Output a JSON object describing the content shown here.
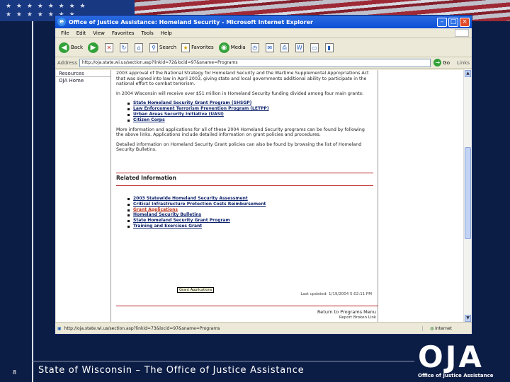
{
  "browser": {
    "title": "Office of Justice Assistance: Homeland Security - Microsoft Internet Explorer",
    "menu": [
      "File",
      "Edit",
      "View",
      "Favorites",
      "Tools",
      "Help"
    ],
    "toolbar": {
      "back": "Back",
      "search": "Search",
      "favorites": "Favorites",
      "media": "Media"
    },
    "address_label": "Address",
    "address_value": "http://oja.state.wi.us/section.asp?linkid=72&locid=97&sname=Programs",
    "go": "Go",
    "links": "Links",
    "status_url": "http://oja.state.wi.us/section.asp?linkid=73&locid=97&sname=Programs",
    "status_zone": "Internet"
  },
  "left_nav": [
    "Resources",
    "OJA Home"
  ],
  "content": {
    "p1": "2003 approval of the National Strategy for Homeland Security and the Wartime Supplemental Appropriations Act that was signed into law in April 2003, giving state and local governments additional ability to participate in the national effort to combat terrorism.",
    "p2": "In 2004 Wisconsin will receive over $51 million in Homeland Security funding divided among four main grants:",
    "grants": [
      "State Homeland Security Grant Program (SHSGP)",
      "Law Enforcement Terrorism Prevention Program (LETPP)",
      "Urban Areas Security Initiative (UASI)",
      "Citizen Corps"
    ],
    "p3": "More information and applications for all of these 2004 Homeland Security programs can be found by following the above links. Applications include detailed information on grant policies and procedures.",
    "p4": "Detailed information on Homeland Security Grant policies can also be found by browsing the list of Homeland Security Bulletins.",
    "related_heading": "Related Information",
    "related": [
      "2003 Statewide Homeland Security Assessment",
      "Critical Infrastructure Protection Costs Reimbursement",
      "Grant Applications",
      "Homeland Security Bulletins",
      "State Homeland Security Grant Program",
      "Training and Exercises Grant"
    ],
    "tooltip": "Grant Applications",
    "last_updated": "Last updated: 1/19/2004 5:02:11 PM",
    "return_link": "Return to Programs Menu",
    "report_link": "Report Broken Link"
  },
  "footer": {
    "page_number": "8",
    "title": "State of Wisconsin – The Office of Justice Assistance",
    "logo_letters": "OJA",
    "logo_sub": "Office of Justice Assistance"
  }
}
